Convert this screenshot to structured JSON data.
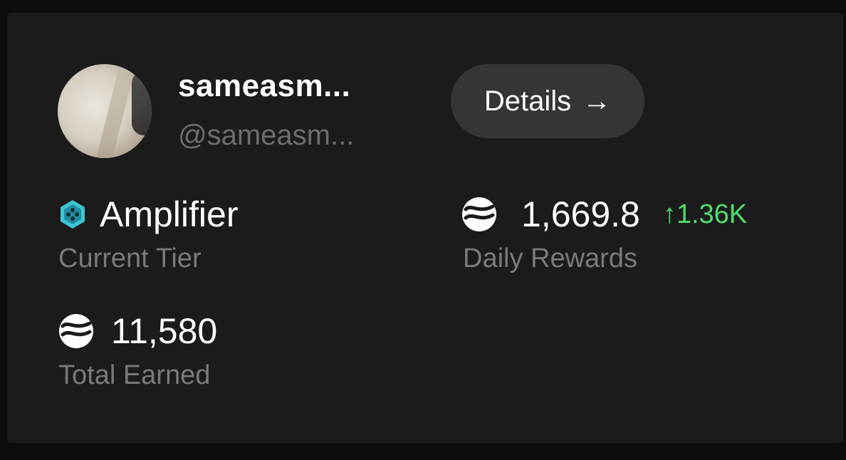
{
  "profile": {
    "display_name": "sameasm...",
    "handle": "@sameasm..."
  },
  "actions": {
    "details_label": "Details",
    "details_arrow": "→"
  },
  "stats": {
    "tier": {
      "value": "Amplifier",
      "label": "Current Tier",
      "icon": "tier-gem-icon",
      "icon_color": "#3ec6d4"
    },
    "daily_rewards": {
      "value": "1,669.8",
      "change": "↑1.36K",
      "label": "Daily Rewards",
      "icon": "token-icon",
      "change_color": "#4fdc6c"
    },
    "total_earned": {
      "value": "11,580",
      "label": "Total Earned",
      "icon": "token-icon"
    }
  }
}
